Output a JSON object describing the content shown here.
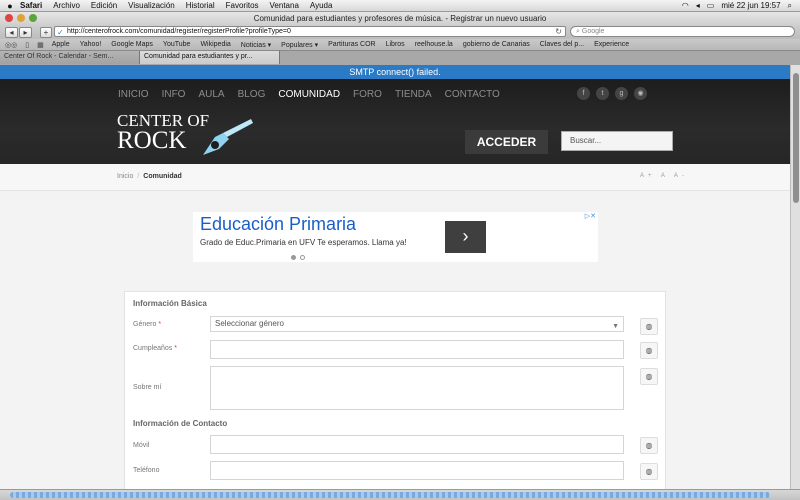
{
  "menubar": {
    "apple": "",
    "items": [
      "Safari",
      "Archivo",
      "Edición",
      "Visualización",
      "Historial",
      "Favoritos",
      "Ventana",
      "Ayuda"
    ],
    "clock": "mié 22 jun  19:57"
  },
  "window": {
    "title": "Comunidad para estudiantes y profesores de música. - Registrar un nuevo usuario"
  },
  "toolbar": {
    "url": "http://centerofrock.com/comunidad/register/registerProfile?profileType=0",
    "search_placeholder": "Google"
  },
  "bookmarks": [
    "Apple",
    "Yahoo!",
    "Google Maps",
    "YouTube",
    "Wikipedia",
    "Noticias ▾",
    "Populares ▾",
    "Partituras COR",
    "Libros",
    "reelhouse.la",
    "gobierno de Canarias",
    "Claves del p...",
    "Experience"
  ],
  "tabs": [
    {
      "label": "Center Of Rock - Calendar - Sem..."
    },
    {
      "label": "Comunidad para estudiantes y pr..."
    }
  ],
  "page": {
    "alert": "SMTP connect() failed.",
    "nav": [
      "INICIO",
      "INFO",
      "AULA",
      "BLOG",
      "COMUNIDAD",
      "FORO",
      "TIENDA",
      "CONTACTO"
    ],
    "logo_line1": "CENTER OF",
    "logo_line2": "ROCK",
    "acceder": "ACCEDER",
    "search_placeholder": "Buscar...",
    "breadcrumb": {
      "home": "Inicio",
      "sep": "/",
      "current": "Comunidad"
    },
    "font_size_controls": "A+ A A-",
    "ad": {
      "headline": "Educación Primaria",
      "text": "Grado de Educ.Primaria en UFV Te esperamos. Llama ya!",
      "arrow": "›",
      "badge": "▷✕"
    },
    "form": {
      "section_basic": "Información Básica",
      "gender_label": "Género",
      "required_mark": "*",
      "gender_value": "Seleccionar género",
      "birthday_label": "Cumpleaños",
      "about_label": "Sobre mí",
      "section_contact": "Información de Contacto",
      "mobile_label": "Móvil",
      "phone_label": "Teléfono"
    }
  }
}
